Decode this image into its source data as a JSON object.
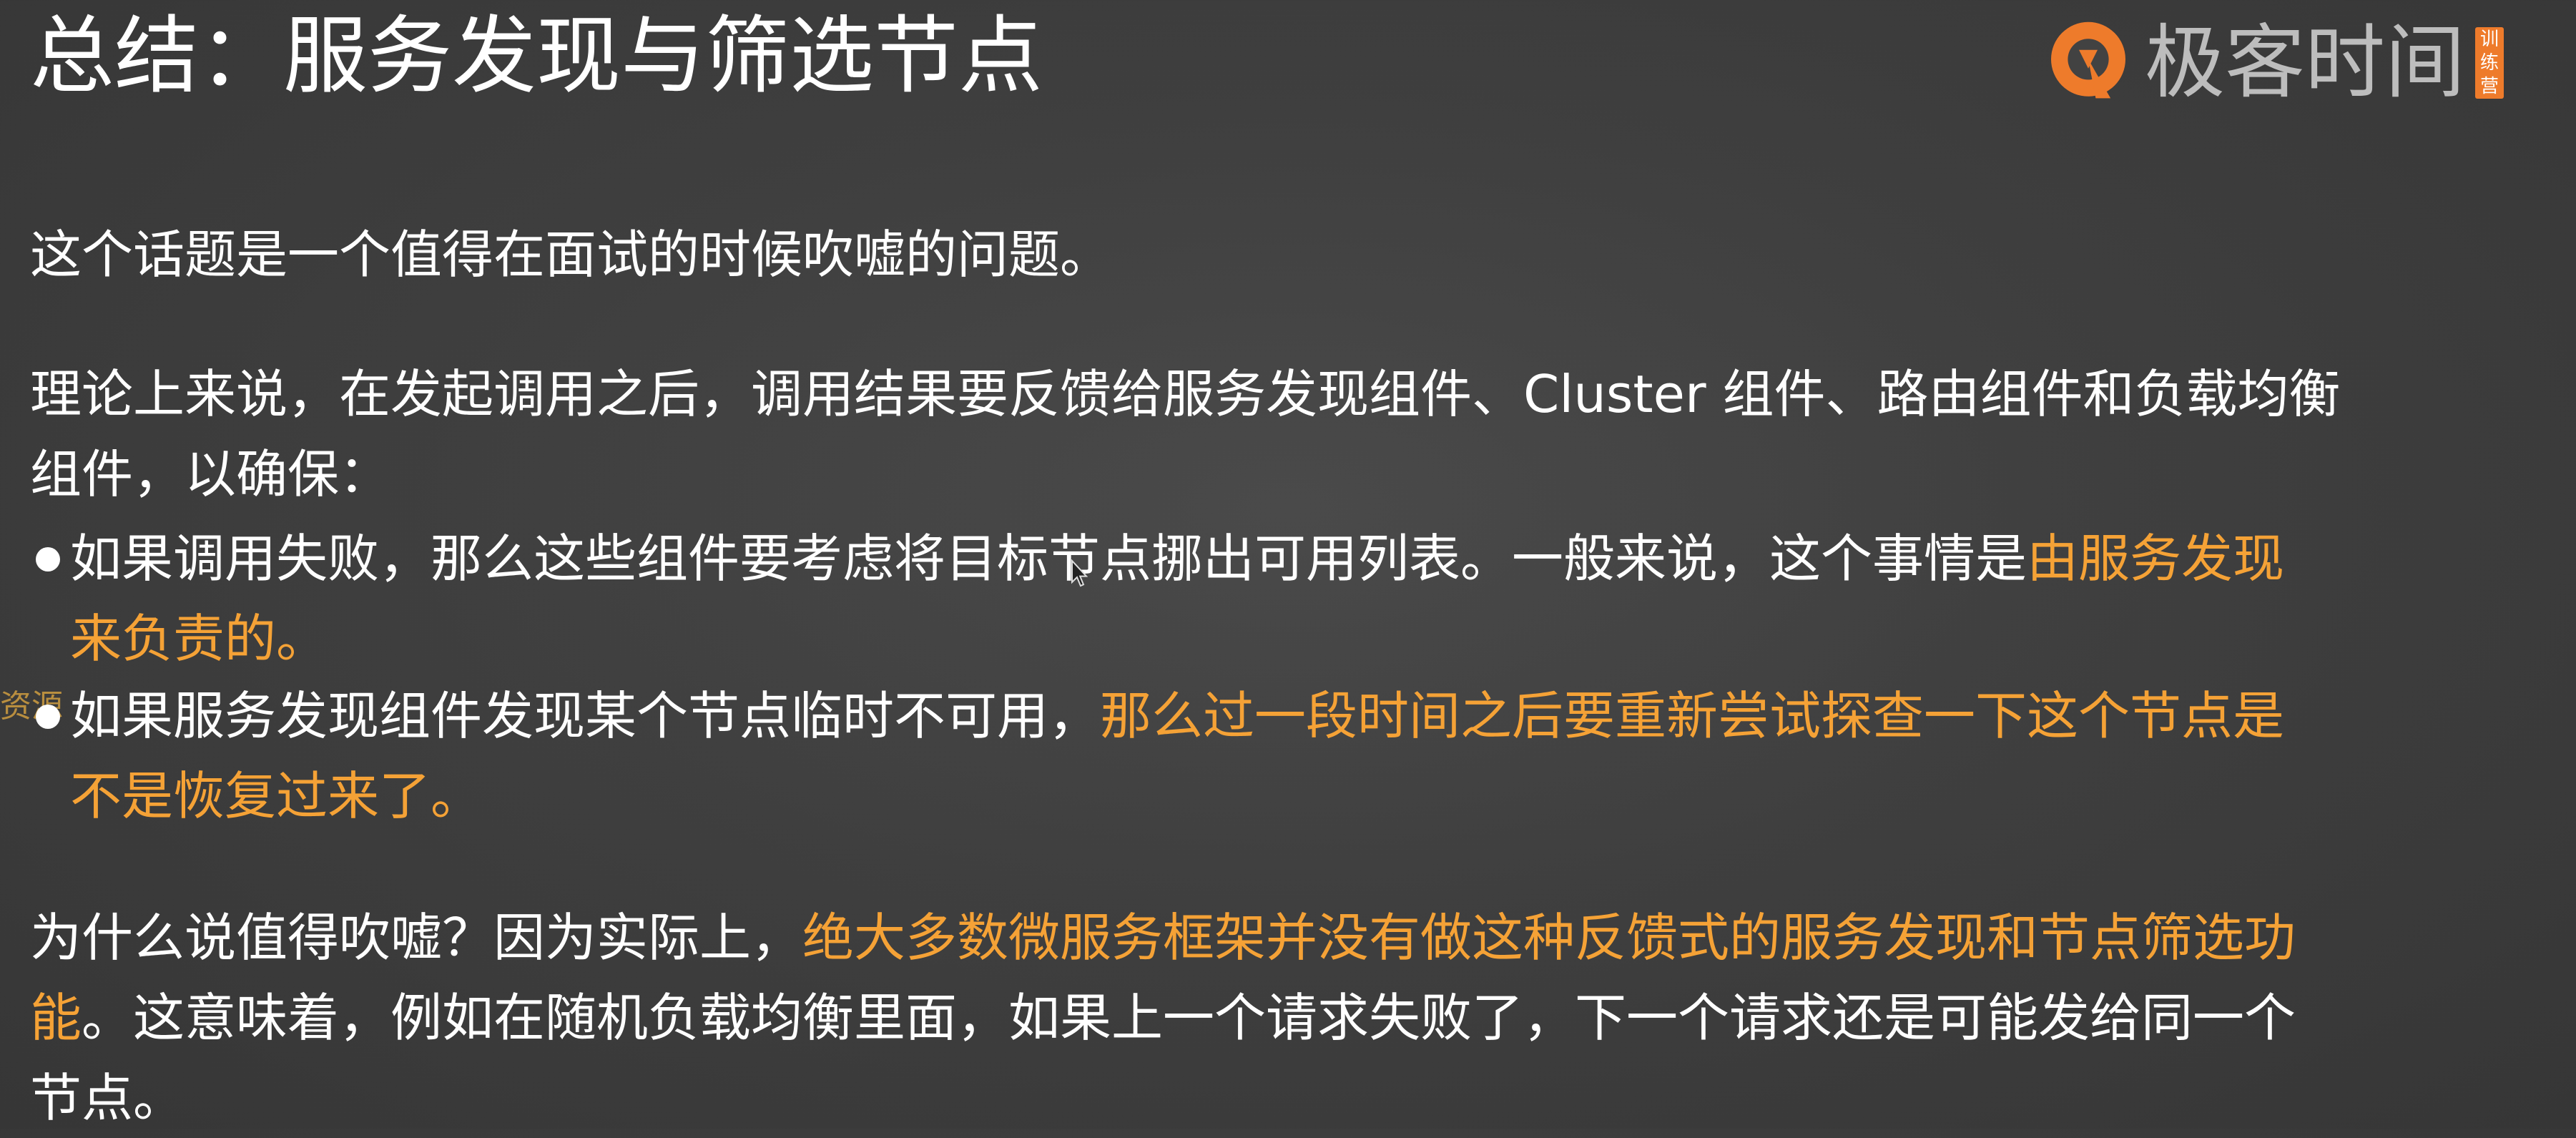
{
  "title": "总结：服务发现与筛选节点",
  "logo": {
    "text": "极客时间",
    "badge_line1": "训",
    "badge_line2": "练",
    "badge_line3": "营",
    "brand_color": "#ee7b2b"
  },
  "intro": "这个话题是一个值得在面试的时候吹嘘的问题。",
  "theory": {
    "line1": "理论上来说，在发起调用之后，调用结果要反馈给服务发现组件、Cluster 组件、路由组件和负载均衡",
    "line2": "组件，以确保："
  },
  "bullets": [
    {
      "line1_normal": "如果调用失败，那么这些组件要考虑将目标节点挪出可用列表。一般来说，这个事情是",
      "line1_highlight": "由服务发现",
      "line2_highlight": "来负责的。"
    },
    {
      "line1_normal": "如果服务发现组件发现某个节点临时不可用，",
      "line1_highlight": "那么过一段时间之后要重新尝试探查一下这个节点是",
      "line2_highlight": "不是恢复过来了。"
    }
  ],
  "why": {
    "line1_normal": "为什么说值得吹嘘？因为实际上，",
    "line1_highlight": "绝大多数微服务框架并没有做这种反馈式的服务发现和节点筛选功",
    "line2_highlight": "能",
    "line2_normal": "。这意味着，例如在随机负载均衡里面，如果上一个请求失败了，下一个请求还是可能发给同一个",
    "line3_normal": "节点。"
  },
  "watermark": "资源",
  "colors": {
    "text": "#ffffff",
    "highlight": "#f5a236",
    "background": "#424242"
  }
}
